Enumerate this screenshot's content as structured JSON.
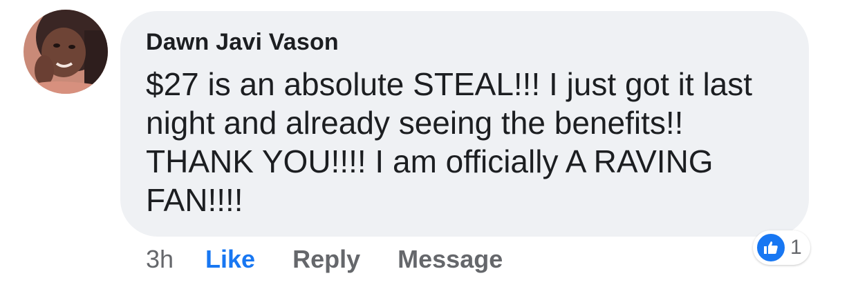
{
  "comment": {
    "author": "Dawn Javi Vason",
    "text": "$27 is an absolute STEAL!!! I just got it last night and already seeing the benefits!! THANK YOU!!!! I am officially A RAVING FAN!!!!",
    "timestamp": "3h",
    "avatar_icon": "profile-photo"
  },
  "actions": {
    "like_label": "Like",
    "reply_label": "Reply",
    "message_label": "Message"
  },
  "reactions": {
    "icon": "thumbs-up-icon",
    "count": "1",
    "color": "#1877f2"
  },
  "colors": {
    "bubble": "#eff1f4",
    "text": "#1c1e21",
    "muted": "#65676b",
    "accent": "#1877f2"
  }
}
